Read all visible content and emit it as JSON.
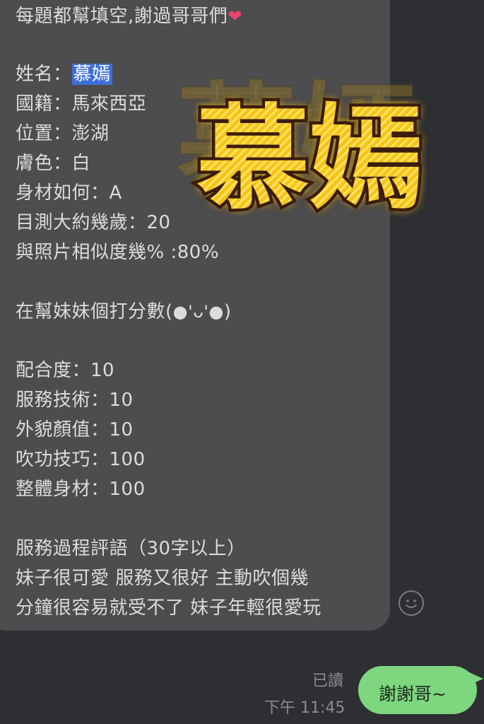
{
  "incoming": {
    "lines": [
      {
        "pre": "每題都幫填空,謝過哥哥們",
        "heart": "❤"
      },
      {
        "label": "姓名：",
        "value": "慕嫣"
      },
      {
        "text": "國籍：馬來西亞"
      },
      {
        "text": "位置：澎湖"
      },
      {
        "text": "膚色：白"
      },
      {
        "text": "身材如何：A"
      },
      {
        "text": "目測大約幾歲：20"
      },
      {
        "text": "與照片相似度幾% :80%"
      },
      {
        "pre": "在幫妹妹個打分數(",
        "face": "●'ᴗ'●",
        "post": ")"
      },
      {
        "text": "配合度：10"
      },
      {
        "text": "服務技術：10"
      },
      {
        "text": "外貌顏值：10"
      },
      {
        "text": "吹功技巧：100"
      },
      {
        "text": "整體身材：100"
      },
      {
        "text": "服務過程評語（30字以上）"
      },
      {
        "text": "妹子很可愛 服務又很好  主動吹個幾"
      },
      {
        "text": "分鐘很容易就受不了 妹子年輕很愛玩"
      }
    ]
  },
  "outgoing": {
    "read_status": "已讀",
    "time": "下午 11:45",
    "text": "謝謝哥~"
  },
  "sticker": {
    "text": "慕嫣",
    "fill_color": "#f5c518",
    "outline_color": "#3a1e08"
  },
  "icons": {
    "reaction": "smiley-icon"
  },
  "colors": {
    "background": "#2d2f33",
    "bubble_in": "#4d4d4f",
    "bubble_out": "#7ed67f",
    "highlight": "#3e6fd8"
  }
}
